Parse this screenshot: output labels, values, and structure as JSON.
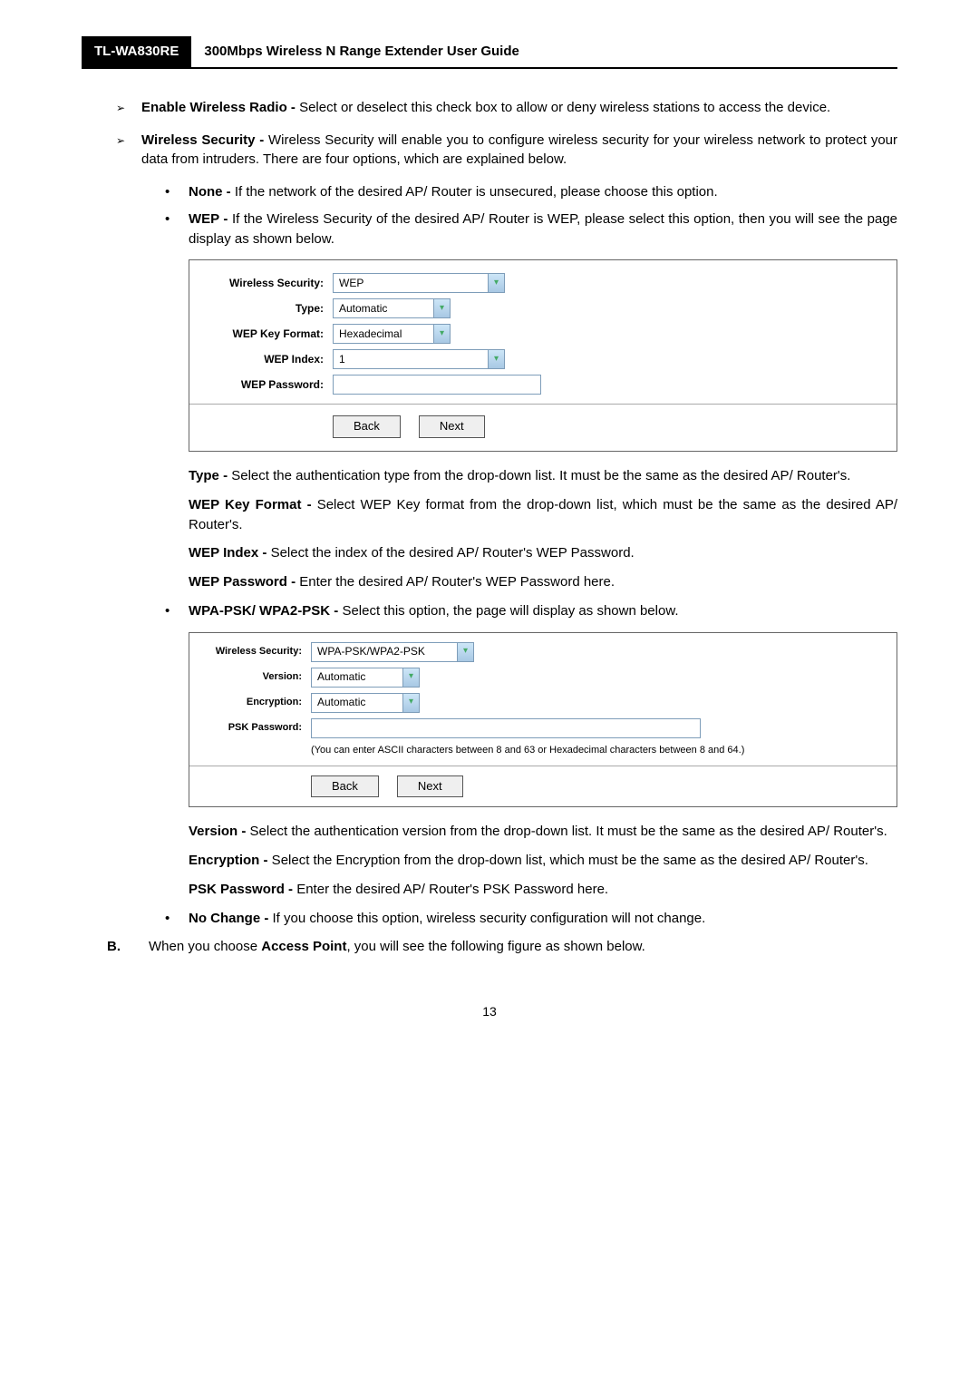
{
  "header": {
    "model": "TL-WA830RE",
    "title": "300Mbps Wireless N Range Extender User Guide"
  },
  "bullets": {
    "enable_radio_bold": "Enable Wireless Radio -",
    "enable_radio_text": " Select or deselect this check box to allow or deny wireless stations to access the device.",
    "wsec_bold": "Wireless Security -",
    "wsec_text": " Wireless Security will enable you to configure wireless security for your wireless network to protect your data from intruders. There are four options, which are explained below.",
    "none_bold": "None -",
    "none_text": " If the network of the desired AP/ Router is unsecured, please choose this option.",
    "wep_bold": "WEP -",
    "wep_text": " If the Wireless Security of the desired AP/ Router is WEP, please select this option, then you will see the page display as shown below."
  },
  "wep_form": {
    "l_sec": "Wireless Security:",
    "l_type": "Type:",
    "l_fmt": "WEP Key Format:",
    "l_idx": "WEP Index:",
    "l_pwd": "WEP Password:",
    "v_sec": "WEP",
    "v_type": "Automatic",
    "v_fmt": "Hexadecimal",
    "v_idx": "1",
    "btn_back": "Back",
    "btn_next": "Next"
  },
  "wep_desc": {
    "type_b": "Type -",
    "type_t": " Select the authentication type from the drop-down list. It must be the same as the desired AP/ Router's.",
    "fmt_b": "WEP Key Format -",
    "fmt_t": " Select WEP Key format from the drop-down list, which must be the same as the desired AP/ Router's.",
    "idx_b": "WEP Index -",
    "idx_t": " Select the index of the desired AP/ Router's WEP Password.",
    "pwd_b": "WEP Password -",
    "pwd_t": " Enter the desired AP/ Router's WEP Password here."
  },
  "wpa_bullet": {
    "b": "WPA-PSK/ WPA2-PSK -",
    "t": " Select this option, the page will display as shown below."
  },
  "wpa_form": {
    "l_sec": "Wireless Security:",
    "l_ver": "Version:",
    "l_enc": "Encryption:",
    "l_psk": "PSK Password:",
    "v_sec": "WPA-PSK/WPA2-PSK",
    "v_ver": "Automatic",
    "v_enc": "Automatic",
    "hint": "(You can enter ASCII characters between 8 and 63 or Hexadecimal characters between 8 and 64.)",
    "btn_back": "Back",
    "btn_next": "Next"
  },
  "wpa_desc": {
    "ver_b": "Version -",
    "ver_t": " Select the authentication version from the drop-down list. It must be the same as the desired AP/ Router's.",
    "enc_b": "Encryption -",
    "enc_t": " Select the Encryption from the drop-down list, which must be the same as the desired AP/ Router's.",
    "psk_b": "PSK Password -",
    "psk_t": " Enter the desired AP/ Router's PSK Password here."
  },
  "nochange": {
    "b": "No Change -",
    "t": " If you choose this option, wireless security configuration will not change."
  },
  "letterB": {
    "letter": "B.",
    "pre": "When you choose ",
    "bold": "Access Point",
    "post": ", you will see the following figure as shown below."
  },
  "page_number": "13",
  "arrow_glyph": "➢",
  "dot_glyph": "•",
  "chev_glyph": "▾"
}
